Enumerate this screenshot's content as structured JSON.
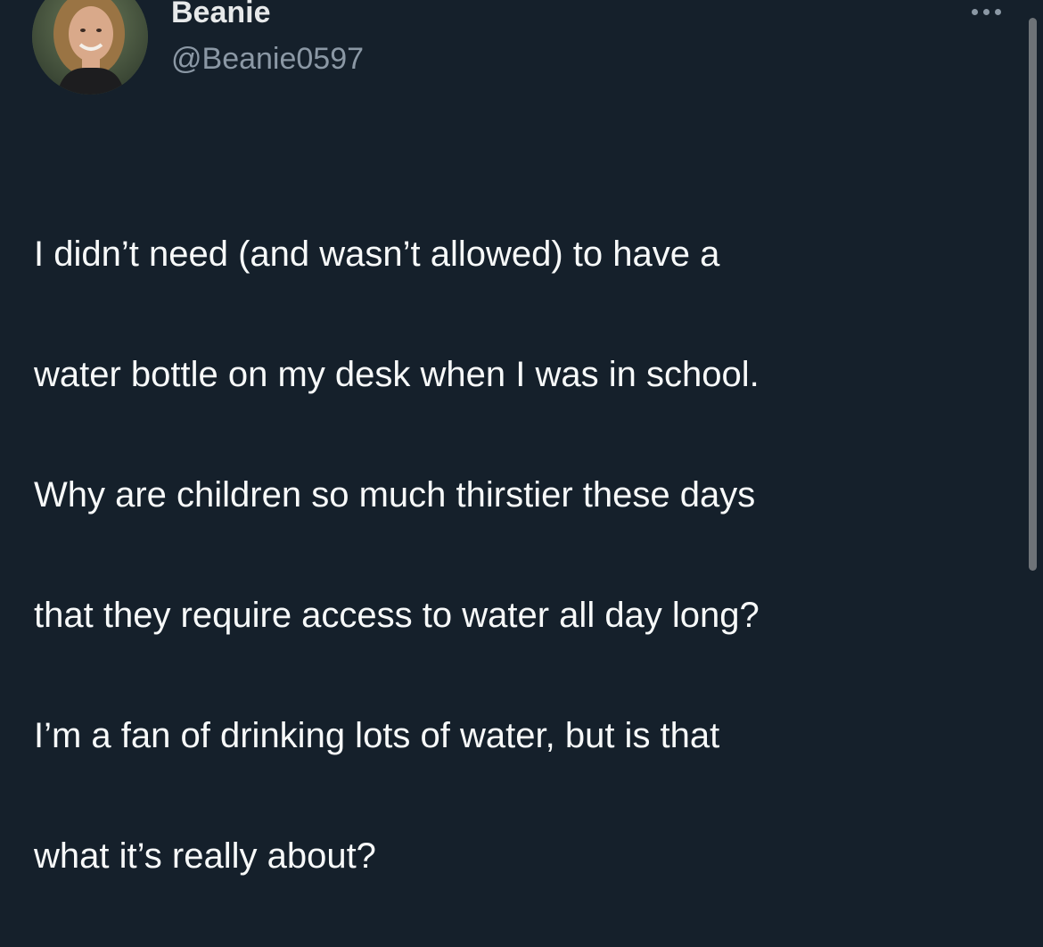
{
  "colors": {
    "background": "#15202b",
    "text_primary": "#e7e9ea",
    "text_secondary": "#8b98a5",
    "scrollbar": "#6e7378"
  },
  "author": {
    "display_name": "Beanie",
    "handle": "@Beanie0597",
    "avatar_icon": "profile-photo"
  },
  "more_icon": "more-horizontal-icon",
  "tweet": {
    "text_lines": [
      "I didn’t need (and wasn’t allowed) to have a",
      "water bottle on my desk when I was in school.",
      "Why are children so much thirstier these days",
      "that they require access to water all day long?",
      "I’m a fan of drinking lots of water, but is that",
      "what it’s really about?"
    ]
  }
}
